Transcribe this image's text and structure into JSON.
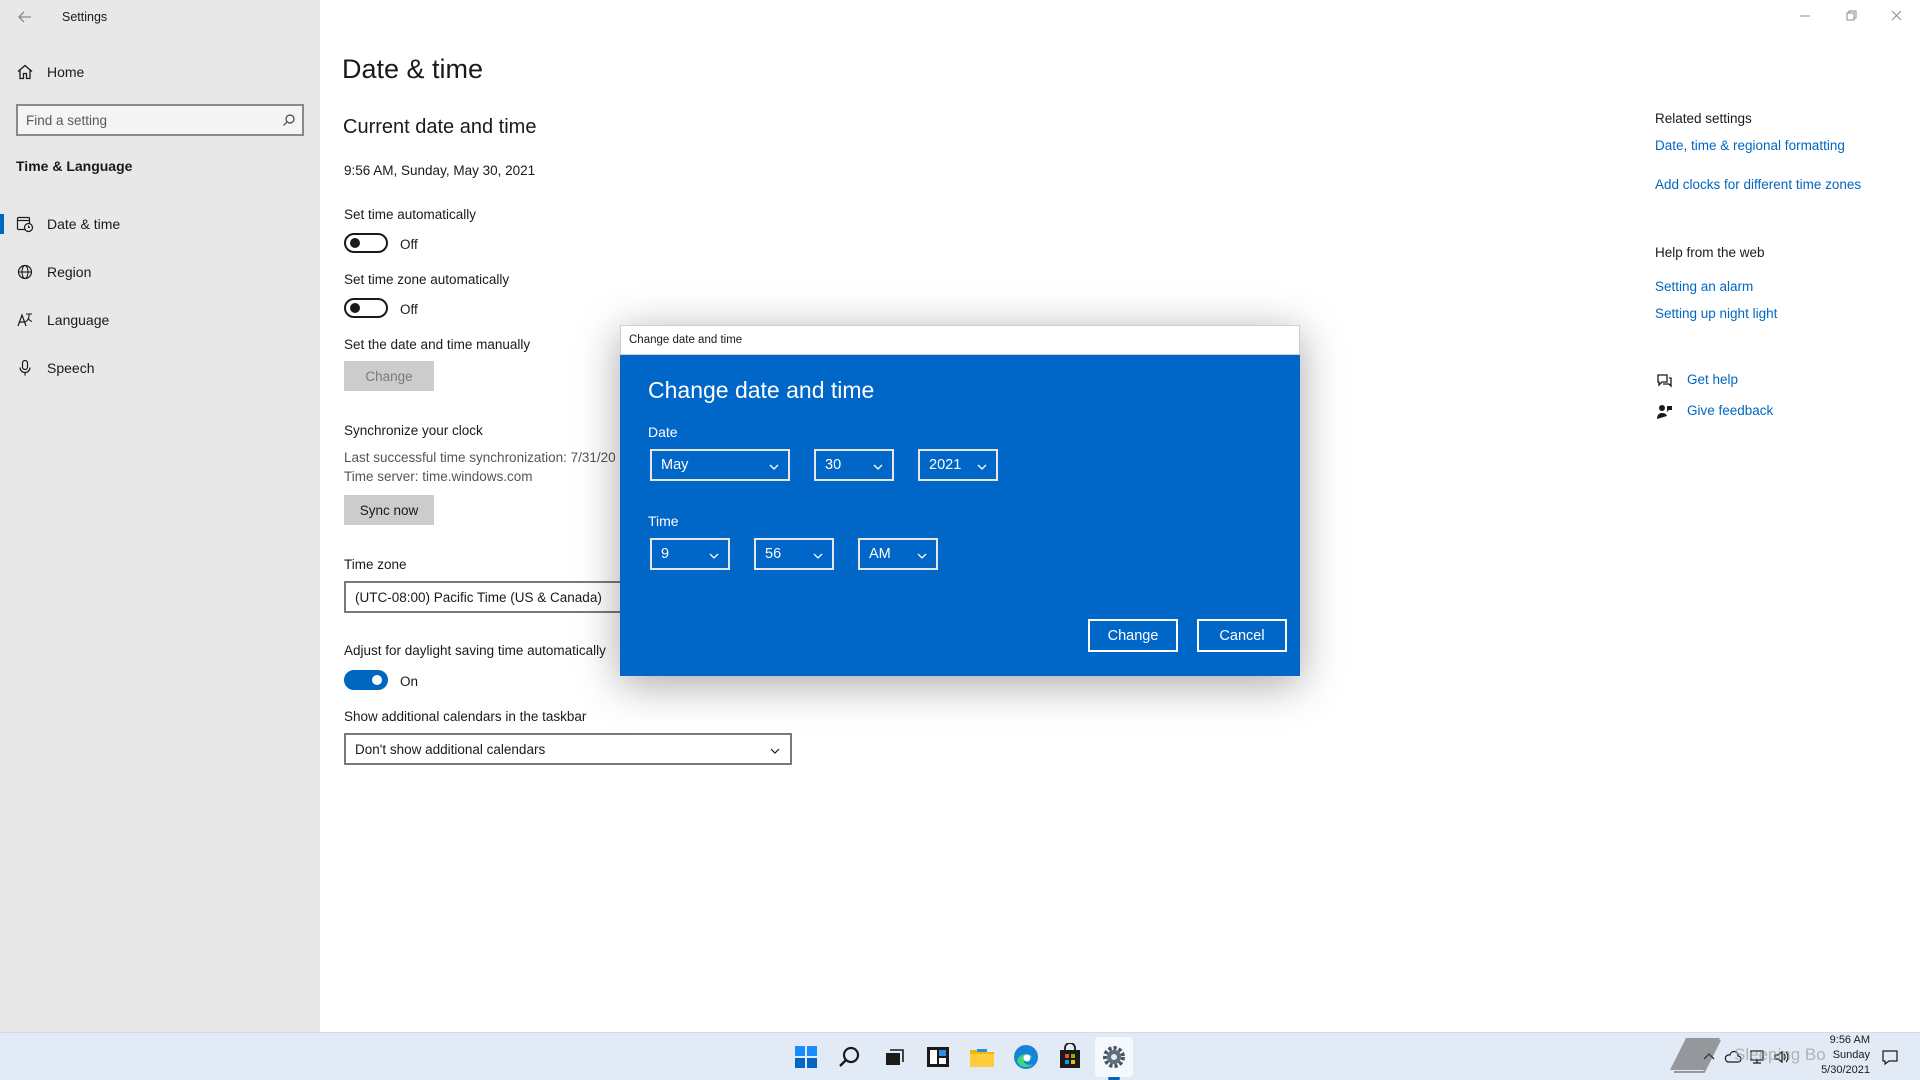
{
  "window": {
    "title": "Settings"
  },
  "sidebar": {
    "home": "Home",
    "search_placeholder": "Find a setting",
    "section": "Time & Language",
    "items": [
      {
        "label": "Date & time",
        "icon": "calendar-clock-icon",
        "selected": true
      },
      {
        "label": "Region",
        "icon": "globe-icon"
      },
      {
        "label": "Language",
        "icon": "language-icon"
      },
      {
        "label": "Speech",
        "icon": "microphone-icon"
      }
    ]
  },
  "main": {
    "title": "Date & time",
    "subtitle": "Current date and time",
    "current_datetime": "9:56 AM, Sunday, May 30, 2021",
    "set_time_auto": {
      "label": "Set time automatically",
      "state": "Off"
    },
    "set_zone_auto": {
      "label": "Set time zone automatically",
      "state": "Off"
    },
    "manual": {
      "label": "Set the date and time manually",
      "button": "Change"
    },
    "sync": {
      "label": "Synchronize your clock",
      "last_sync": "Last successful time synchronization: 7/31/20",
      "server": "Time server: time.windows.com",
      "button": "Sync now"
    },
    "timezone": {
      "label": "Time zone",
      "value": "(UTC-08:00) Pacific Time (US & Canada)"
    },
    "dst": {
      "label": "Adjust for daylight saving time automatically",
      "state": "On"
    },
    "calendars": {
      "label": "Show additional calendars in the taskbar",
      "value": "Don't show additional calendars"
    }
  },
  "related": {
    "heading": "Related settings",
    "links": [
      "Date, time & regional formatting",
      "Add clocks for different time zones"
    ],
    "help_heading": "Help from the web",
    "help_links": [
      "Setting an alarm",
      "Setting up night light"
    ],
    "get_help": "Get help",
    "give_feedback": "Give feedback"
  },
  "dialog": {
    "window_title": "Change date and time",
    "heading": "Change date and time",
    "date_label": "Date",
    "month": "May",
    "day": "30",
    "year": "2021",
    "time_label": "Time",
    "hour": "9",
    "minute": "56",
    "ampm": "AM",
    "change_button": "Change",
    "cancel_button": "Cancel"
  },
  "taskbar": {
    "clock_time": "9:56 AM",
    "clock_day": "Sunday",
    "clock_date": "5/30/2021",
    "watermark": "Sleeping Bo"
  },
  "colors": {
    "accent": "#0067c0",
    "dialog_bg": "#0067c8",
    "sidebar_bg": "#e8e8e8",
    "taskbar_bg": "#e2ebf5"
  }
}
